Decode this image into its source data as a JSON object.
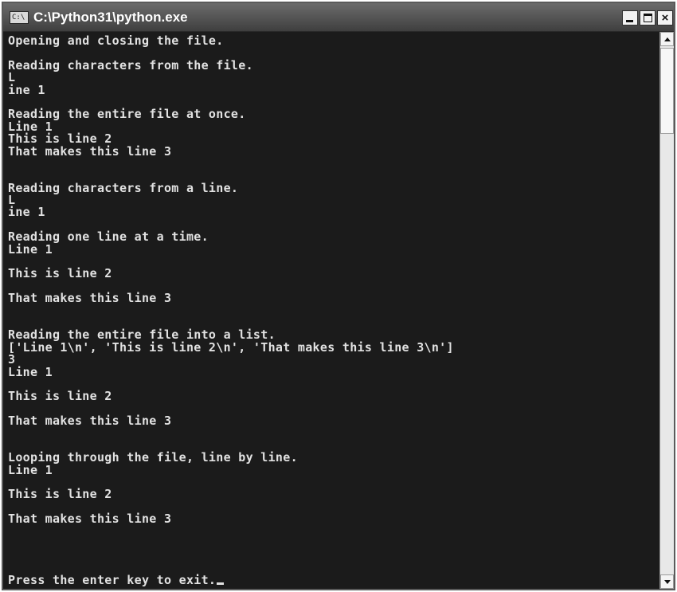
{
  "window": {
    "title": "C:\\Python31\\python.exe",
    "icon_label": "C:\\",
    "close_label": "×"
  },
  "console": {
    "lines": [
      "Opening and closing the file.",
      "",
      "Reading characters from the file.",
      "L",
      "ine 1",
      "",
      "Reading the entire file at once.",
      "Line 1",
      "This is line 2",
      "That makes this line 3",
      "",
      "",
      "Reading characters from a line.",
      "L",
      "ine 1",
      "",
      "Reading one line at a time.",
      "Line 1",
      "",
      "This is line 2",
      "",
      "That makes this line 3",
      "",
      "",
      "Reading the entire file into a list.",
      "['Line 1\\n', 'This is line 2\\n', 'That makes this line 3\\n']",
      "3",
      "Line 1",
      "",
      "This is line 2",
      "",
      "That makes this line 3",
      "",
      "",
      "Looping through the file, line by line.",
      "Line 1",
      "",
      "This is line 2",
      "",
      "That makes this line 3",
      "",
      "",
      "",
      "",
      "Press the enter key to exit."
    ]
  },
  "colors": {
    "console_background": "#1b1b1b",
    "console_text": "#e2e2e2",
    "titlebar": "#4a4a4a"
  }
}
